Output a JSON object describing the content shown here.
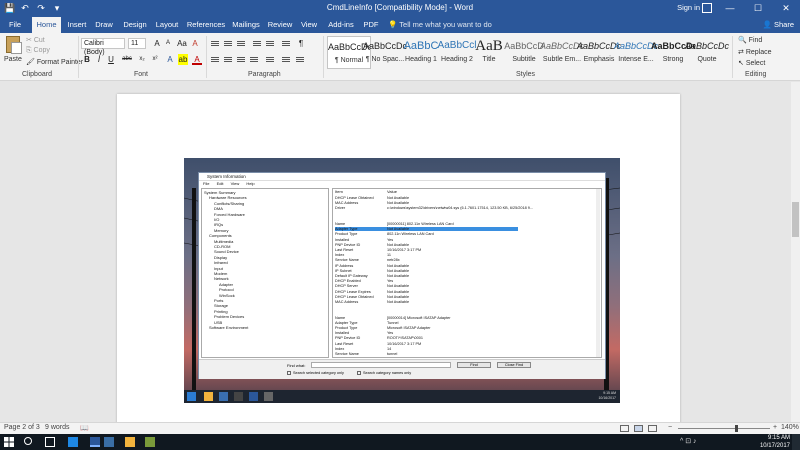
{
  "window": {
    "title": "CmdLineInfo [Compatibility Mode] - Word",
    "sign_in": "Sign in",
    "share": "Share",
    "minimize": "—",
    "maximize": "☐",
    "close": "✕"
  },
  "qat": {
    "save": "💾",
    "undo": "↶",
    "redo": "↷",
    "customize": "▾"
  },
  "tabs": [
    {
      "label": "File"
    },
    {
      "label": "Home"
    },
    {
      "label": "Insert"
    },
    {
      "label": "Draw"
    },
    {
      "label": "Design"
    },
    {
      "label": "Layout"
    },
    {
      "label": "References"
    },
    {
      "label": "Mailings"
    },
    {
      "label": "Review"
    },
    {
      "label": "View"
    },
    {
      "label": "Add-ins"
    },
    {
      "label": "PDF"
    }
  ],
  "tell_me": "Tell me what you want to do",
  "clipboard": {
    "paste": "Paste",
    "cut": "Cut",
    "copy": "Copy",
    "format_painter": "Format Painter",
    "label": "Clipboard"
  },
  "font": {
    "name": "Calibri (Body)",
    "size": "11",
    "bold": "B",
    "italic": "I",
    "underline": "U",
    "strike": "abc",
    "subscript": "x₂",
    "superscript": "x²",
    "grow": "A",
    "shrink": "A",
    "case": "Aa",
    "clear": "A",
    "label": "Font"
  },
  "paragraph": {
    "label": "Paragraph",
    "pilcrow": "¶"
  },
  "styles": {
    "label": "Styles",
    "items": [
      {
        "sample": "AaBbCcDc",
        "name": "¶ Normal"
      },
      {
        "sample": "AaBbCcDc",
        "name": "¶ No Spac..."
      },
      {
        "sample": "AaBbC",
        "name": "Heading 1"
      },
      {
        "sample": "AaBbCcl",
        "name": "Heading 2"
      },
      {
        "sample": "AaB",
        "name": "Title"
      },
      {
        "sample": "AaBbCcD",
        "name": "Subtitle"
      },
      {
        "sample": "AaBbCcDc",
        "name": "Subtle Em..."
      },
      {
        "sample": "AaBbCcDc",
        "name": "Emphasis"
      },
      {
        "sample": "AaBbCcDc",
        "name": "Intense E..."
      },
      {
        "sample": "AaBbCcDc",
        "name": "Strong"
      },
      {
        "sample": "AaBbCcDc",
        "name": "Quote"
      }
    ]
  },
  "editing": {
    "find": "Find",
    "replace": "Replace",
    "select": "Select",
    "label": "Editing"
  },
  "sysinfo": {
    "title": "System Information",
    "menu": [
      "File",
      "Edit",
      "View",
      "Help"
    ],
    "tree": [
      {
        "label": "System Summary",
        "level": 0
      },
      {
        "label": "Hardware Resources",
        "level": 1
      },
      {
        "label": "Conflicts/Sharing",
        "level": 2
      },
      {
        "label": "DMA",
        "level": 2
      },
      {
        "label": "Forced Hardware",
        "level": 2
      },
      {
        "label": "I/O",
        "level": 2
      },
      {
        "label": "IRQs",
        "level": 2
      },
      {
        "label": "Memory",
        "level": 2
      },
      {
        "label": "Components",
        "level": 1
      },
      {
        "label": "Multimedia",
        "level": 2
      },
      {
        "label": "CD-ROM",
        "level": 2
      },
      {
        "label": "Sound Device",
        "level": 2
      },
      {
        "label": "Display",
        "level": 2
      },
      {
        "label": "Infrared",
        "level": 2
      },
      {
        "label": "Input",
        "level": 2
      },
      {
        "label": "Modem",
        "level": 2
      },
      {
        "label": "Network",
        "level": 2
      },
      {
        "label": "Adapter",
        "level": 3
      },
      {
        "label": "Protocol",
        "level": 3
      },
      {
        "label": "WinSock",
        "level": 3
      },
      {
        "label": "Ports",
        "level": 2
      },
      {
        "label": "Storage",
        "level": 2
      },
      {
        "label": "Printing",
        "level": 2
      },
      {
        "label": "Problem Devices",
        "level": 2
      },
      {
        "label": "USB",
        "level": 2
      },
      {
        "label": "Software Environment",
        "level": 1
      }
    ],
    "columns": [
      "Item",
      "Value"
    ],
    "rows": [
      {
        "item": "DHCP Lease Obtained",
        "value": "Not Available"
      },
      {
        "item": "MAC Address",
        "value": "Not Available"
      },
      {
        "item": "Driver",
        "value": "c:\\windows\\system32\\drivers\\netwtw04.sys (6.1.7601.17514, 123.50 KB, 6/25/2018 9..."
      },
      {
        "item": "",
        "value": ""
      },
      {
        "item": "",
        "value": ""
      },
      {
        "item": "Name",
        "value": "[00000011] 802.11n Wireless LAN Card"
      },
      {
        "item": "Adapter Type",
        "value": "Not Available"
      },
      {
        "item": "Product Type",
        "value": "802.11n Wireless LAN Card"
      },
      {
        "item": "Installed",
        "value": "Yes"
      },
      {
        "item": "PNP Device ID",
        "value": "Not Available"
      },
      {
        "item": "Last Reset",
        "value": "10/16/2017 3:17 PM"
      },
      {
        "item": "Index",
        "value": "11"
      },
      {
        "item": "Service Name",
        "value": "netr28x"
      },
      {
        "item": "IP Address",
        "value": "Not Available"
      },
      {
        "item": "IP Subnet",
        "value": "Not Available"
      },
      {
        "item": "Default IP Gateway",
        "value": "Not Available"
      },
      {
        "item": "DHCP Enabled",
        "value": "Yes"
      },
      {
        "item": "DHCP Server",
        "value": "Not Available"
      },
      {
        "item": "DHCP Lease Expires",
        "value": "Not Available"
      },
      {
        "item": "DHCP Lease Obtained",
        "value": "Not Available"
      },
      {
        "item": "MAC Address",
        "value": "Not Available"
      },
      {
        "item": "",
        "value": ""
      },
      {
        "item": "",
        "value": ""
      },
      {
        "item": "Name",
        "value": "[00000014] Microsoft ISATAP Adapter"
      },
      {
        "item": "Adapter Type",
        "value": "Tunnel"
      },
      {
        "item": "Product Type",
        "value": "Microsoft ISATAP Adapter"
      },
      {
        "item": "Installed",
        "value": "Yes"
      },
      {
        "item": "PNP Device ID",
        "value": "ROOT\\*ISATAP\\0001"
      },
      {
        "item": "Last Reset",
        "value": "10/16/2017 3:17 PM"
      },
      {
        "item": "Index",
        "value": "14"
      },
      {
        "item": "Service Name",
        "value": "tunnel"
      }
    ],
    "find_what": "Find what:",
    "find_btn": "Find",
    "close_find_btn": "Close Find",
    "chk_selected": "Search selected category only",
    "chk_names": "Search category names only",
    "clock_time": "9:15 AM",
    "clock_date": "10/16/2017"
  },
  "status": {
    "page": "Page 2 of 3",
    "words": "9 words",
    "zoom_minus": "−",
    "zoom_plus": "+",
    "zoom_level": "140%",
    "zoom_fraction": 0.62
  },
  "taskbar": {
    "time": "9:15 AM",
    "date": "10/17/2017",
    "tray": "^ ⊡ ♪"
  },
  "colors": {
    "word_blue": "#2b579a",
    "highlight": "#3a8fe0"
  }
}
